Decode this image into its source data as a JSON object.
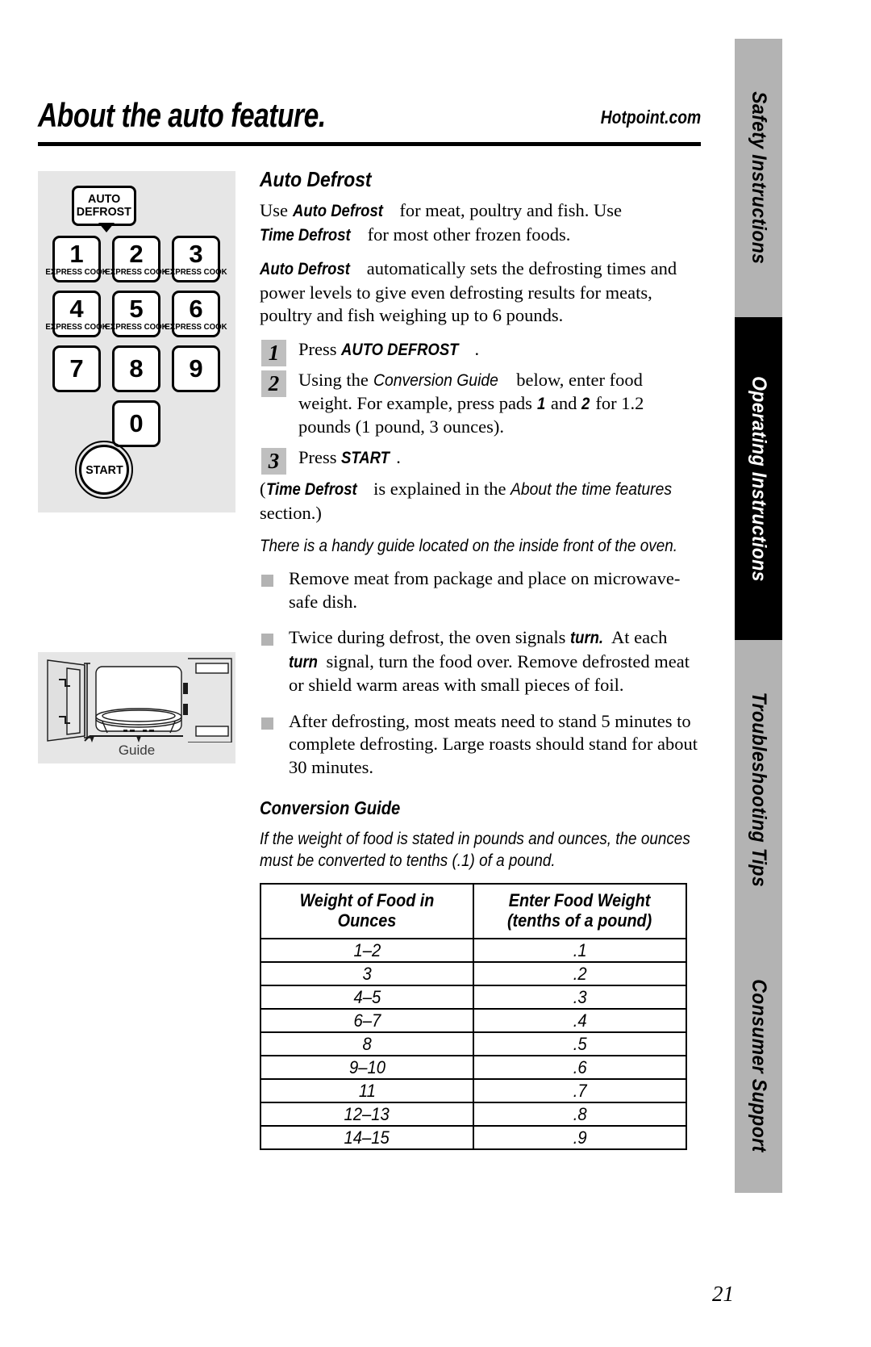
{
  "header": {
    "title": "About the auto feature.",
    "site_url": "Hotpoint.com"
  },
  "side_tabs": [
    {
      "label": "Safety Instructions",
      "background": "#b3b3b3",
      "color": "#000000"
    },
    {
      "label": "Operating Instructions",
      "background": "#000000",
      "color": "#ffffff"
    },
    {
      "label": "Troubleshooting Tips",
      "background": "#b3b3b3",
      "color": "#000000"
    },
    {
      "label": "Consumer Support",
      "background": "#b3b3b3",
      "color": "#000000"
    }
  ],
  "keypad": {
    "auto_defrost_line1": "AUTO",
    "auto_defrost_line2": "DEFROST",
    "express_cook_label": "EXPRESS COOK",
    "keys": [
      {
        "num": "1",
        "sub": "EXPRESS COOK"
      },
      {
        "num": "2",
        "sub": "EXPRESS COOK"
      },
      {
        "num": "3",
        "sub": "EXPRESS COOK"
      },
      {
        "num": "4",
        "sub": "EXPRESS COOK"
      },
      {
        "num": "5",
        "sub": "EXPRESS COOK"
      },
      {
        "num": "6",
        "sub": "EXPRESS COOK"
      },
      {
        "num": "7",
        "sub": ""
      },
      {
        "num": "8",
        "sub": ""
      },
      {
        "num": "9",
        "sub": ""
      },
      {
        "num": "0",
        "sub": ""
      }
    ],
    "start_label": "START"
  },
  "oven_illustration": {
    "caption": "Guide"
  },
  "main": {
    "section_heading": "Auto Defrost",
    "para1": {
      "t1": "Use ",
      "b1": "Auto Defrost",
      "t2": " for meat, poultry and fish. Use ",
      "b2": "Time Defrost",
      "t3": " for most other frozen foods."
    },
    "para2": {
      "b1": "Auto Defrost",
      "t1": " automatically sets the defrosting times and power levels to give even defrosting results for meats, poultry and fish weighing up to 6 pounds."
    },
    "steps": [
      {
        "num": "1",
        "t1": "Press ",
        "b1": "AUTO DEFROST",
        "t2": "."
      },
      {
        "num": "2",
        "t1": "Using the ",
        "i1": "Conversion Guide",
        "t2": " below, enter food weight. For example, press pads ",
        "b1": "1",
        "t3": " and ",
        "b2": "2",
        "t4": " for 1.2 pounds (1 pound, 3 ounces)."
      },
      {
        "num": "3",
        "t1": "Press ",
        "b1": "START",
        "t2": "."
      }
    ],
    "para3": {
      "t1": "(",
      "b1": "Time Defrost",
      "t2": " is explained in the ",
      "i1": "About the time features",
      "t3": " section.)"
    },
    "note": "There is a handy guide located on the inside front of the oven.",
    "bullets": [
      {
        "t1": "Remove meat from package and place on microwave-safe dish."
      },
      {
        "t1": "Twice during defrost, the oven signals ",
        "b1": "turn.",
        "t2": " At each ",
        "b2": "turn",
        "t3": " signal, turn the food over. Remove defrosted meat or shield warm areas with small pieces of foil."
      },
      {
        "t1": "After defrosting, most meats need to stand 5 minutes to complete defrosting. Large roasts should stand for about 30 minutes."
      }
    ],
    "conversion_guide": {
      "heading": "Conversion Guide",
      "intro": "If the weight of food is stated in pounds and ounces, the ounces must be converted to tenths (.1) of a pound.",
      "columns": [
        "Weight of Food in Ounces",
        "Enter Food Weight\n(tenths of a pound)"
      ],
      "column_header_right_line1": "Enter Food Weight",
      "column_header_right_line2": "(tenths of a pound)",
      "rows": [
        {
          "ounces": "1–2",
          "tenths": ".1"
        },
        {
          "ounces": "3",
          "tenths": ".2"
        },
        {
          "ounces": "4–5",
          "tenths": ".3"
        },
        {
          "ounces": "6–7",
          "tenths": ".4"
        },
        {
          "ounces": "8",
          "tenths": ".5"
        },
        {
          "ounces": "9–10",
          "tenths": ".6"
        },
        {
          "ounces": "11",
          "tenths": ".7"
        },
        {
          "ounces": "12–13",
          "tenths": ".8"
        },
        {
          "ounces": "14–15",
          "tenths": ".9"
        }
      ]
    }
  },
  "footer": {
    "page_number": "21"
  }
}
